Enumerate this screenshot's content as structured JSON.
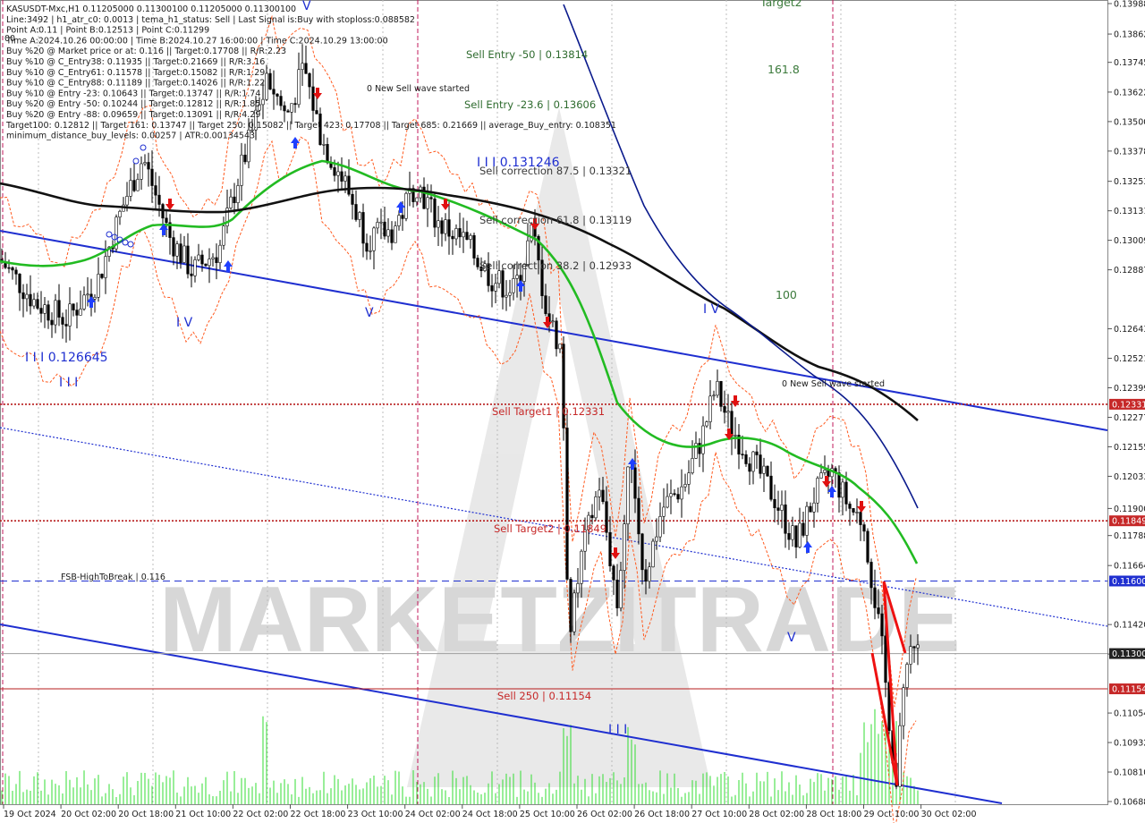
{
  "header": {
    "lines": [
      "KASUSDT-Mxc,H1  0.11205000 0.11300100 0.11205000 0.11300100",
      "Line:3492 | h1_atr_c0: 0.0013 | tema_h1_status: Sell | Last Signal is:Buy with stoploss:0.088582",
      "Point A:0.11 | Point B:0.12513 | Point C:0.11299",
      "Time A:2024.10.26 00:00:00 | Time B:2024.10.27 16:00:00 | Time C:2024.10.29 13:00:00",
      "Buy %20 @ Market price or at: 0.116 || Target:0.17708 || R/R:2.23",
      "Buy %10 @ C_Entry38: 0.11935 || Target:0.21669 || R/R:3.16",
      "Buy %10 @ C_Entry61: 0.11578 || Target:0.15082 || R/R:1.29",
      "Buy %10 @ C_Entry88: 0.11189 || Target:0.14026 || R/R:1.22",
      "Buy %10 @ Entry -23: 0.10643 || Target:0.13747 || R/R:1.74",
      "Buy %20 @ Entry -50: 0.10244 || Target:0.12812 || R/R:1.85",
      "Buy %20 @ Entry -88: 0.09659 || Target:0.13091 || R/R:4.29",
      "Target100: 0.12812 || Target 161: 0.13747 || Target 250: 0.15082 || Target 423: 0.17708 || Target 685: 0.21669 || average_Buy_entry: 0.108351",
      "minimum_distance_buy_levels: 0.00257 | ATR:0.00134543"
    ]
  },
  "chart_data": {
    "type": "candlestick",
    "symbol": "KASUSDT-Mxc",
    "timeframe": "H1",
    "ylim": [
      0.10688,
      0.13988
    ],
    "y_ticks": [
      0.13988,
      0.13862,
      0.13745,
      0.13622,
      0.135,
      0.13378,
      0.13253,
      0.13131,
      0.13009,
      0.12887,
      0.12643,
      0.12521,
      0.12399,
      0.12277,
      0.12155,
      0.12033,
      0.119,
      0.11788,
      0.11664,
      0.1142,
      0.11298,
      0.11054,
      0.10932,
      0.1081,
      0.10688
    ],
    "x_ticks": [
      "19 Oct 2024",
      "20 Oct 02:00",
      "20 Oct 18:00",
      "21 Oct 10:00",
      "22 Oct 02:00",
      "22 Oct 18:00",
      "23 Oct 10:00",
      "24 Oct 02:00",
      "24 Oct 18:00",
      "25 Oct 10:00",
      "26 Oct 02:00",
      "26 Oct 18:00",
      "27 Oct 10:00",
      "28 Oct 02:00",
      "28 Oct 18:00",
      "29 Oct 10:00",
      "30 Oct 02:00"
    ],
    "price_marks": [
      {
        "value": 0.12331,
        "label": "0.12331",
        "color": "#c62828"
      },
      {
        "value": 0.11849,
        "label": "0.11849",
        "color": "#c62828"
      },
      {
        "value": 0.116,
        "label": "0.11600",
        "color": "#1f2fd0"
      },
      {
        "value": 0.113,
        "label": "0.11300",
        "color": "#222222"
      },
      {
        "value": 0.11154,
        "label": "0.11154",
        "color": "#c62828"
      }
    ],
    "horizontal_levels": [
      {
        "value": 0.12331,
        "color": "#b71c1c",
        "style": "dotted"
      },
      {
        "value": 0.11849,
        "color": "#b71c1c",
        "style": "dotted"
      },
      {
        "value": 0.116,
        "color": "#1f2fd0",
        "style": "dashed"
      },
      {
        "value": 0.113,
        "color": "#9e9e9e",
        "style": "solid"
      },
      {
        "value": 0.11154,
        "color": "#b71c1c",
        "style": "solid"
      }
    ],
    "annotations": {
      "sell_entry_50": "Sell Entry -50 | 0.13814",
      "sell_entry_23": "Sell Entry -23.6 | 0.13606",
      "sell_corr_875": "Sell correction 87.5 | 0.13321",
      "sell_corr_618": "Sell correction 61.8 | 0.13119",
      "sell_corr_382": "Sell correction 38.2 | 0.12933",
      "sell_target1": "Sell Target1 | 0.12331",
      "sell_target2": "Sell Target2 | 0.11849",
      "sell_250": "Sell  250 | 0.11154",
      "fsb": "FSB-HighToBreak | 0.116",
      "new_sell_wave_1": "0 New Sell wave started",
      "new_sell_wave_2": "0 New Sell wave started",
      "wave_iii_top": "I I I 0.131246",
      "wave_iii_low": "I I I 0.126645",
      "wave_iii_small": "I I I",
      "wave_iv_1": "I V",
      "wave_v_1": "V",
      "wave_iv_2": "I V",
      "wave_v_2": "V",
      "wave_iii_bottom": "I I I",
      "fib_target2": "Target2",
      "fib_161": "161.8",
      "fib_100": "100",
      "corner_tag": "00",
      "top_v": "V"
    },
    "watermark": "MARKETZITRADE"
  },
  "colors": {
    "background": "#ffffff",
    "green_ma": "#22bb22",
    "black_ma": "#111111",
    "navy_ma": "#0a1a8c",
    "channel": "#1f2fd0",
    "envelope": "#ff5a1f",
    "candle": "#000000",
    "volume": "#33dd33",
    "session": "#c2185b",
    "signal_up": "#1f3fff",
    "signal_down": "#e01010"
  }
}
